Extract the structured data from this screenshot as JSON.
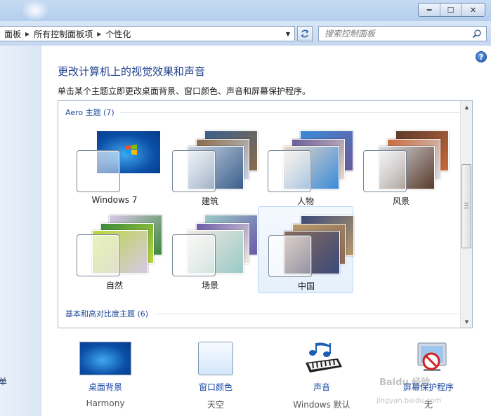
{
  "window": {
    "minimize_glyph": "━",
    "maximize_glyph": "☐",
    "close_glyph": "✕"
  },
  "address": {
    "crumbs": [
      "面板",
      "所有控制面板项",
      "个性化"
    ],
    "search_placeholder": "搜索控制面板"
  },
  "left_pane": {
    "item": "单"
  },
  "help_label": "?",
  "page": {
    "title": "更改计算机上的视觉效果和声音",
    "subtitle": "单击某个主题立即更改桌面背景、窗口颜色、声音和屏幕保护程序。"
  },
  "themes": {
    "aero_header": "Aero 主题 (7)",
    "basic_header": "基本和高对比度主题 (6)",
    "items": [
      {
        "label": "Windows 7",
        "colors": [
          "#0b4ea6",
          "#3fa9ef",
          "#063b86"
        ]
      },
      {
        "label": "建筑",
        "colors": [
          "#3a5f8a",
          "#8a6a4a",
          "#c9d4e4"
        ]
      },
      {
        "label": "人物",
        "colors": [
          "#3a8bd8",
          "#6a5a9a",
          "#e8d8c8"
        ]
      },
      {
        "label": "风景",
        "colors": [
          "#5a3a2a",
          "#c86a3a",
          "#d8dce4"
        ]
      },
      {
        "label": "自然",
        "colors": [
          "#d8c8e8",
          "#3a8a3a",
          "#b8d83a"
        ]
      },
      {
        "label": "场景",
        "colors": [
          "#9acac8",
          "#6a5aa8",
          "#f0e8e0"
        ]
      },
      {
        "label": "中国",
        "colors": [
          "#3a4a7a",
          "#b89a6a",
          "#8a6a5a"
        ]
      }
    ],
    "selected": "中国"
  },
  "settings": [
    {
      "label": "桌面背景",
      "value": "Harmony",
      "icon": "desktop-background-icon"
    },
    {
      "label": "窗口颜色",
      "value": "天空",
      "icon": "window-color-icon"
    },
    {
      "label": "声音",
      "value": "Windows 默认",
      "icon": "sound-icon"
    },
    {
      "label": "屏幕保护程序",
      "value": "无",
      "icon": "screensaver-icon"
    }
  ],
  "watermark": {
    "line1": "Baidu 经验",
    "line2": "jingyan.baidu.com"
  }
}
